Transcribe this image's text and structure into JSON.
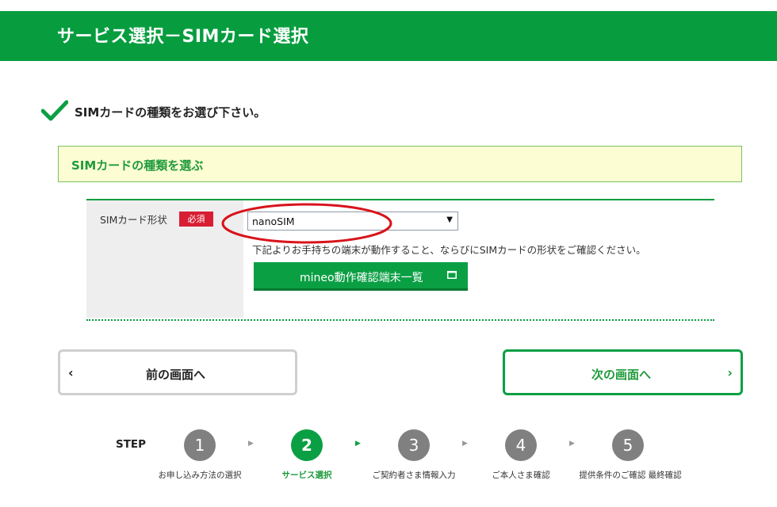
{
  "header": {
    "title": "サービス選択－SIMカード選択"
  },
  "instruction": {
    "text": "SIMカードの種類をお選び下さい。"
  },
  "section": {
    "title": "SIMカードの種類を選ぶ"
  },
  "form": {
    "field_label": "SIMカード形状",
    "required_badge": "必須",
    "select_value": "nanoSIM",
    "hint": "下記よりお手持ちの端末が動作すること、ならびにSIMカードの形状をご確認ください。",
    "device_button_label": "mineo動作確認端末一覧"
  },
  "nav": {
    "prev_label": "前の画面へ",
    "next_label": "次の画面へ"
  },
  "steps": {
    "label": "STEP",
    "items": [
      {
        "number": "1",
        "caption": "お申し込み方法の選択"
      },
      {
        "number": "2",
        "caption": "サービス選択"
      },
      {
        "number": "3",
        "caption": "ご契約者さま情報入力"
      },
      {
        "number": "4",
        "caption": "ご本人さま確認"
      },
      {
        "number": "5",
        "caption": "提供条件のご確認 最終確認"
      }
    ]
  },
  "colors": {
    "brand_green": "#079d3f",
    "required_red": "#d81e33",
    "section_bg": "#fdfdd4",
    "highlight_ellipse": "#d8131b"
  },
  "icons": [
    "check-icon",
    "select-arrow-icon",
    "window-icon",
    "chevron-left-icon",
    "chevron-right-icon",
    "step-arrow-icon"
  ]
}
